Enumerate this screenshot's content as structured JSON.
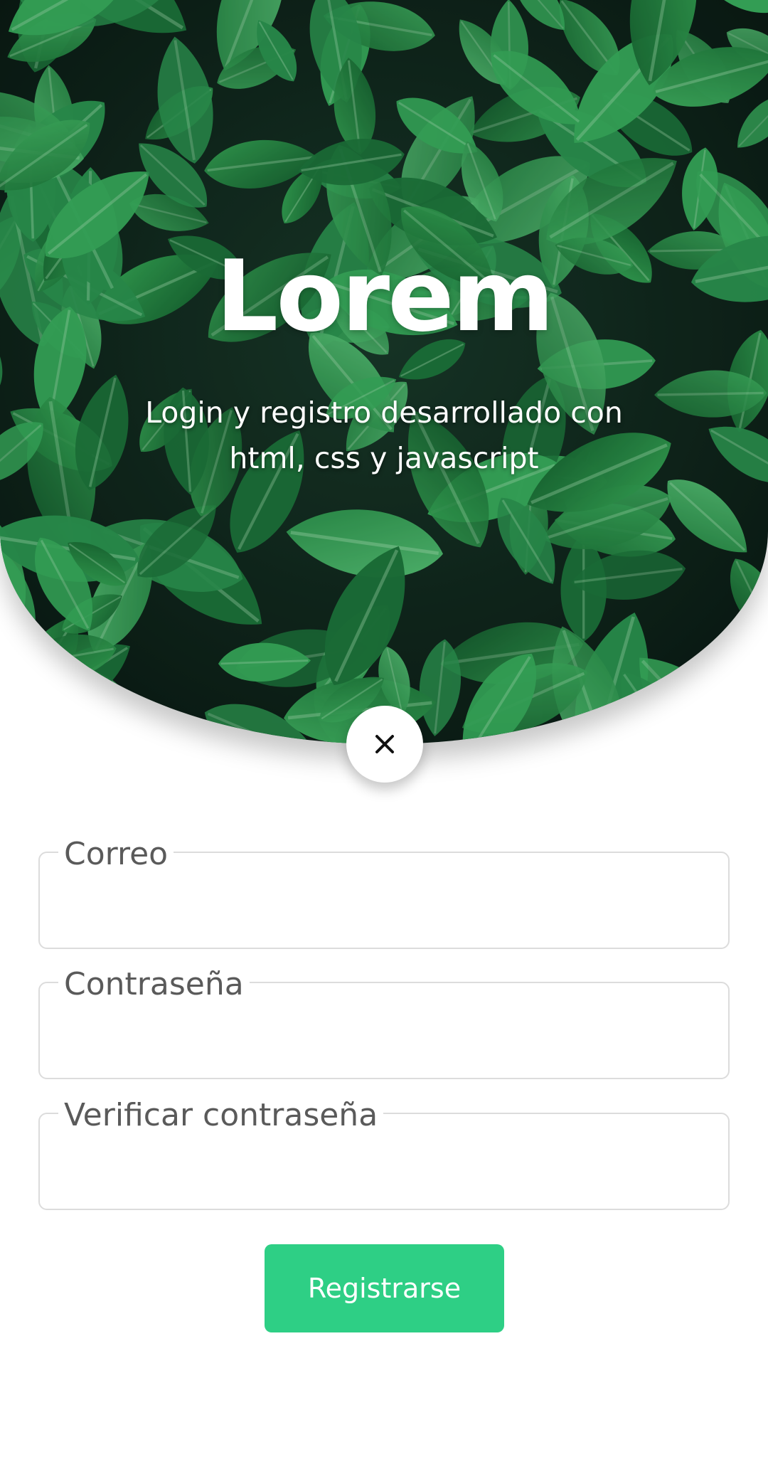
{
  "hero": {
    "title": "Lorem",
    "subtitle": "Login y registro desarrollado con html, css y javascript",
    "background": "leaves-photo"
  },
  "close_button": {
    "icon": "close-icon"
  },
  "form": {
    "fields": [
      {
        "label": "Correo",
        "value": "",
        "placeholder": ""
      },
      {
        "label": "Contraseña",
        "value": "",
        "placeholder": ""
      },
      {
        "label": "Verificar contraseña",
        "value": "",
        "placeholder": ""
      }
    ],
    "submit_label": "Registrarse"
  },
  "colors": {
    "accent": "#2ecf85",
    "field_border": "#dcdcdc",
    "label_text": "#5a5a5a",
    "leaf_dark": "#0b1a14",
    "leaf_green": "#2a9a4a"
  }
}
